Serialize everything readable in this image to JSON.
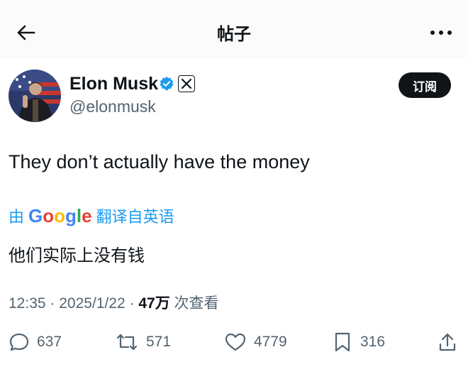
{
  "header": {
    "title": "帖子",
    "back_icon": "arrow-left-icon",
    "more_icon": "more-horizontal-icon"
  },
  "author": {
    "name": "Elon Musk",
    "handle": "@elonmusk",
    "verified_icon": "verified-badge-icon",
    "affiliation_icon": "x-logo-icon",
    "subscribe_label": "订阅"
  },
  "tweet": {
    "text": "They don’t actually have the money",
    "translation": {
      "prefix": "由",
      "provider": "Google",
      "suffix": "翻译自英语",
      "text": "他们实际上没有钱"
    },
    "time": "12:35",
    "date": "2025/1/22",
    "views": "47万",
    "views_label": "次查看"
  },
  "actions": {
    "replies": "637",
    "reposts": "571",
    "likes": "4779",
    "bookmarks": "316"
  },
  "colors": {
    "accent": "#1d9bf0",
    "text": "#0f1419",
    "secondary": "#536471"
  }
}
